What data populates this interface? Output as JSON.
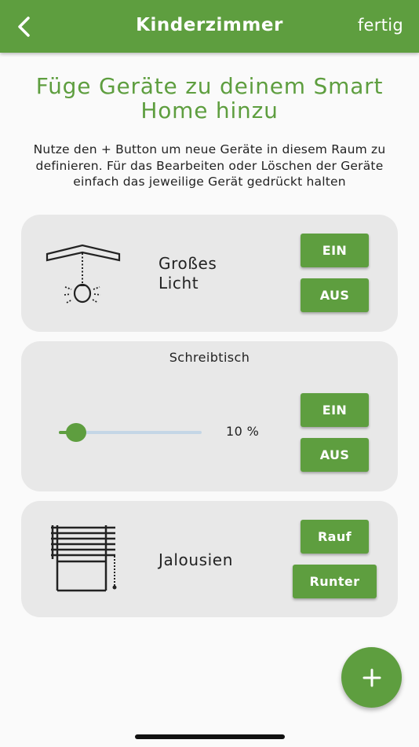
{
  "appbar": {
    "title": "Kinderzimmer",
    "done_label": "fertig"
  },
  "headline": "Füge Geräte zu deinem Smart Home hinzu",
  "intro": "Nutze den + Button um neue Geräte in diesem Raum zu definieren. Für das Bearbeiten oder Löschen der Geräte einfach das jeweilige Gerät gedrückt halten",
  "devices": [
    {
      "name": "Großes Licht",
      "icon": "ceiling-lamp-icon",
      "on_label": "EIN",
      "off_label": "AUS"
    },
    {
      "name": "Schreibtisch",
      "slider_value": 10,
      "slider_text": "10 %",
      "on_label": "EIN",
      "off_label": "AUS"
    },
    {
      "name": "Jalousien",
      "icon": "blinds-icon",
      "up_label": "Rauf",
      "down_label": "Runter"
    }
  ],
  "fab": {
    "icon": "plus-icon"
  },
  "colors": {
    "accent": "#5e9e3f",
    "card": "#e8e8e8",
    "slider_track": "#c4d6e6"
  }
}
